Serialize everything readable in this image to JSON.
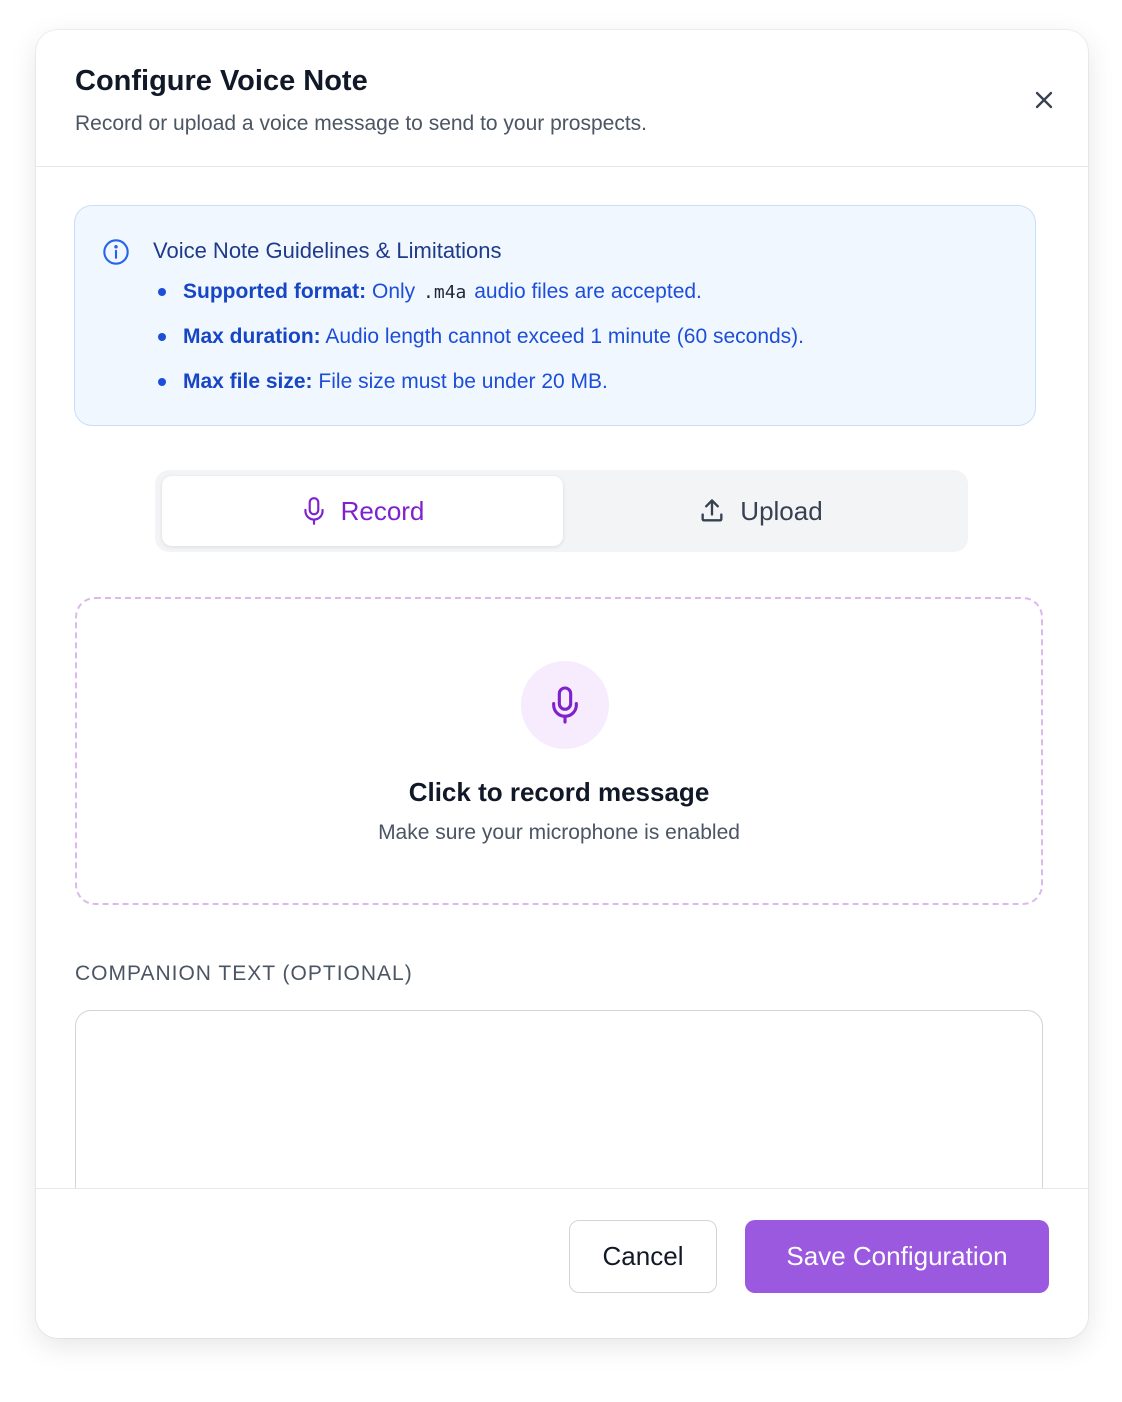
{
  "dialog": {
    "title": "Configure Voice Note",
    "subtitle": "Record or upload a voice message to send to your prospects."
  },
  "guidelines": {
    "title": "Voice Note Guidelines & Limitations",
    "items": [
      {
        "label": "Supported format:",
        "text_before": "Only",
        "code": ".m4a",
        "text_after": "audio files are accepted."
      },
      {
        "label": "Max duration:",
        "text": "Audio length cannot exceed 1 minute (60 seconds)."
      },
      {
        "label": "Max file size:",
        "text": "File size must be under 20 MB."
      }
    ]
  },
  "tabs": {
    "record_label": "Record",
    "upload_label": "Upload",
    "active": "Record"
  },
  "record_zone": {
    "title": "Click to record message",
    "subtitle": "Make sure your microphone is enabled"
  },
  "companion": {
    "label": "COMPANION TEXT (OPTIONAL)",
    "value": "",
    "placeholder": ""
  },
  "footer": {
    "cancel_label": "Cancel",
    "save_label": "Save Configuration"
  },
  "icons": {
    "close": "close-icon",
    "info": "info-icon",
    "record_tab": "microphone-icon",
    "upload_tab": "upload-icon",
    "record_zone": "microphone-icon"
  },
  "colors": {
    "accent": "#7e22ce",
    "primary_button": "#9b59e0",
    "info_text": "#1d4ed8",
    "info_bg": "#f1f7ff"
  }
}
